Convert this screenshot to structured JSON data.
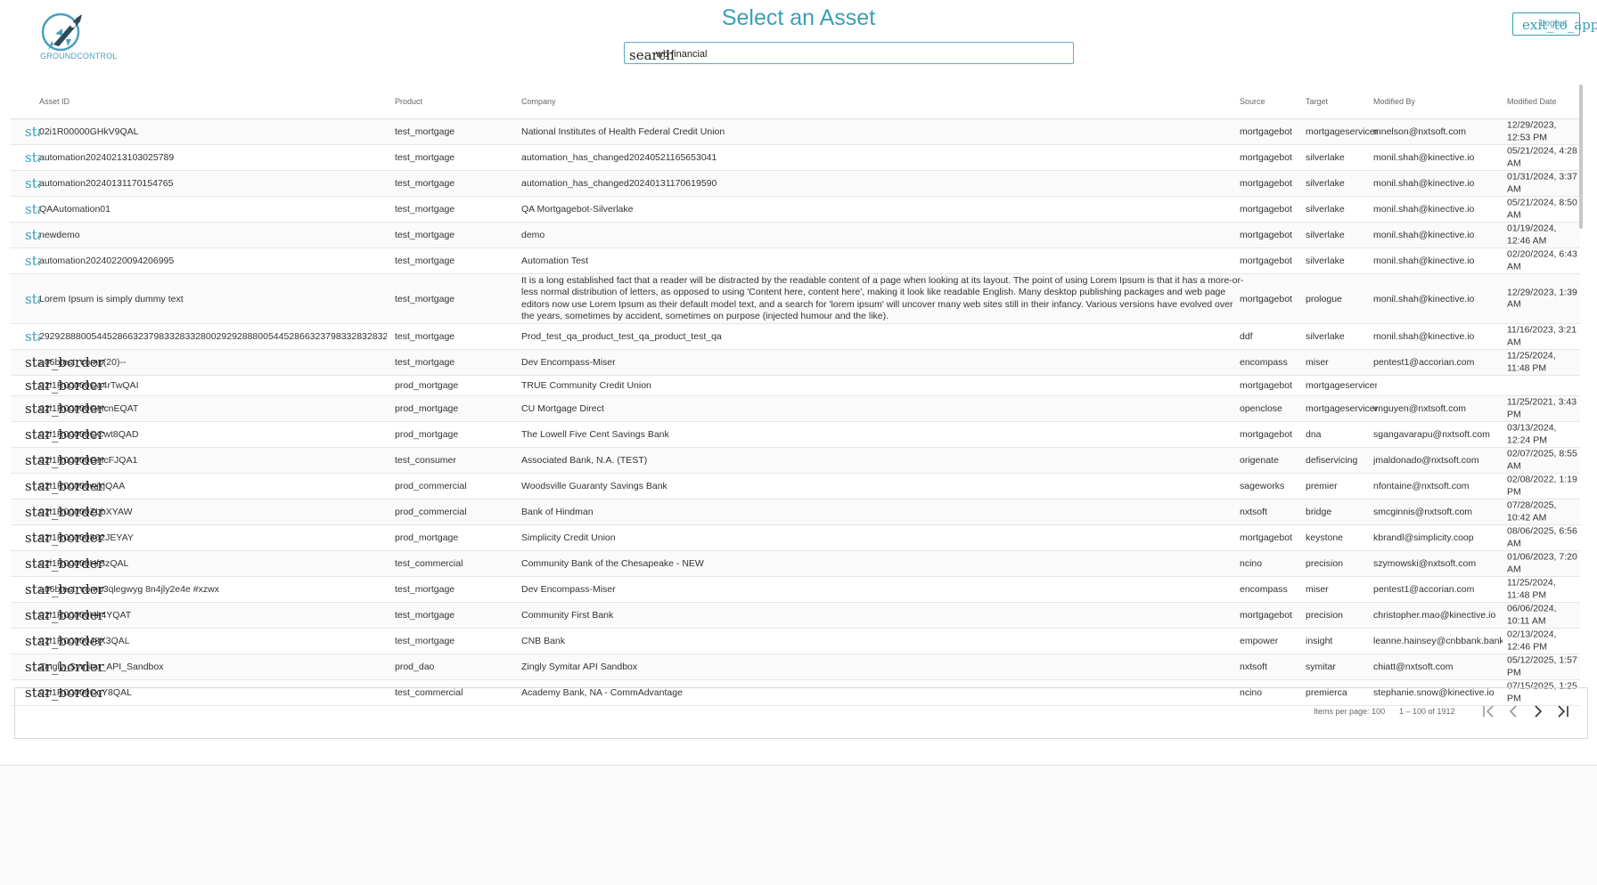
{
  "app": {
    "logo_text": "GROUNDCONTROL",
    "title": "Select an Asset",
    "search": {
      "icon_text": "search",
      "value": "wb financial"
    },
    "exit_button": {
      "label1": "exit_to_app",
      "label2": "Logout"
    },
    "colors": {
      "accent": "#3a9fb5"
    }
  },
  "table": {
    "headers": {
      "asset_id": "Asset ID",
      "product": "Product",
      "company": "Company",
      "source": "Source",
      "target": "Target",
      "modified_by": "Modified By",
      "modified_date": "Modified Date"
    },
    "rows": [
      {
        "star": "star",
        "starred": true,
        "id": "02i1R00000GHkV9QAL",
        "product": "test_mortgage",
        "company": "National Institutes of Health Federal Credit Union",
        "source": "mortgagebot",
        "target": "mortgageservicer",
        "modified_by": "mnelson@nxtsoft.com",
        "date": "12/29/2023, 12:53 PM"
      },
      {
        "star": "star",
        "starred": true,
        "id": "automation20240213103025789",
        "product": "test_mortgage",
        "company": "automation_has_changed20240521165653041",
        "source": "mortgagebot",
        "target": "silverlake",
        "modified_by": "monil.shah@kinective.io",
        "date": "05/21/2024, 4:28 AM"
      },
      {
        "star": "star",
        "starred": true,
        "id": "automation20240131170154765",
        "product": "test_mortgage",
        "company": "automation_has_changed20240131170619590",
        "source": "mortgagebot",
        "target": "silverlake",
        "modified_by": "monil.shah@kinective.io",
        "date": "01/31/2024, 3:37 AM"
      },
      {
        "star": "star",
        "starred": true,
        "id": "QAAutomation01",
        "product": "test_mortgage",
        "company": "QA Mortgagebot-Silverlake",
        "source": "mortgagebot",
        "target": "silverlake",
        "modified_by": "monil.shah@kinective.io",
        "date": "05/21/2024, 8:50 AM"
      },
      {
        "star": "star",
        "starred": true,
        "id": "newdemo",
        "product": "test_mortgage",
        "company": "demo",
        "source": "mortgagebot",
        "target": "silverlake",
        "modified_by": "monil.shah@kinective.io",
        "date": "01/19/2024, 12:46 AM"
      },
      {
        "star": "star",
        "starred": true,
        "id": "automation20240220094206995",
        "product": "test_mortgage",
        "company": "Automation Test",
        "source": "mortgagebot",
        "target": "silverlake",
        "modified_by": "monil.shah@kinective.io",
        "date": "02/20/2024, 6:43 AM"
      },
      {
        "star": "star",
        "starred": true,
        "id": "Lorem Ipsum is simply dummy text",
        "product": "test_mortgage",
        "company": "It is a long established fact that a reader will be distracted by the readable content of a page when looking at its layout. The point of using Lorem Ipsum is that it has a more-or-less normal distribution of letters, as opposed to using 'Content here, content here', making it look like readable English. Many desktop publishing packages and web page editors now use Lorem Ipsum as their default model text, and a search for 'lorem ipsum' will uncover many web sites still in their infancy. Various versions have evolved over the years, sometimes by accident, sometimes on purpose (injected humour and the like).",
        "source": "mortgagebot",
        "target": "prologue",
        "modified_by": "monil.shah@kinective.io",
        "date": "12/29/2023, 1:39 AM"
      },
      {
        "star": "star",
        "starred": true,
        "id": "2929288800544528663237983328332800292928880054452866323798332832832",
        "product": "test_mortgage",
        "company": "Prod_test_qa_product_test_qa_product_test_qa",
        "source": "ddf",
        "target": "silverlake",
        "modified_by": "monil.shah@kinective.io",
        "date": "11/16/2023, 3:21 AM"
      },
      {
        "star": "star_border",
        "starred": false,
        "id": "a06btest_comp(20)--",
        "product": "test_mortgage",
        "company": "Dev Encompass-Miser",
        "source": "encompass",
        "target": "miser",
        "modified_by": "pentest1@accorian.com",
        "date": "11/25/2024, 11:48 PM"
      },
      {
        "star": "star_border",
        "starred": false,
        "id": "02i1R00000Qa4rTwQAI",
        "product": "prod_mortgage",
        "company": "TRUE Community Credit Union",
        "source": "mortgagebot",
        "target": "mortgageservicer",
        "modified_by": "",
        "date": ""
      },
      {
        "star": "star_border",
        "starred": false,
        "id": "02i1R00000GHcnEQAT",
        "product": "prod_mortgage",
        "company": "CU Mortgage Direct",
        "source": "openclose",
        "target": "mortgageservicer",
        "modified_by": "vnguyen@nxtsoft.com",
        "date": "11/25/2021, 3:43 PM"
      },
      {
        "star": "star_border",
        "starred": false,
        "id": "02i1R00000QCwt8QAD",
        "product": "prod_mortgage",
        "company": "The Lowell Five Cent Savings Bank",
        "source": "mortgagebot",
        "target": "dna",
        "modified_by": "sgangavarapu@nxtsoft.com",
        "date": "03/13/2024, 12:24 PM"
      },
      {
        "star": "star_border",
        "starred": false,
        "id": "02i1R00000GHcFJQA1",
        "product": "test_consumer",
        "company": "Associated Bank, N.A. (TEST)",
        "source": "origenate",
        "target": "defiservicing",
        "modified_by": "jmaldonado@nxtsoft.com",
        "date": "02/07/2025, 8:55 AM"
      },
      {
        "star": "star_border",
        "starred": false,
        "id": "02i1R00000wjkjQAA",
        "product": "prod_commercial",
        "company": "Woodsville Guaranty Savings Bank",
        "source": "sageworks",
        "target": "premier",
        "modified_by": "nfontaine@nxtsoft.com",
        "date": "02/08/2022, 1:19 PM"
      },
      {
        "star": "star_border",
        "starred": false,
        "id": "02i1R00000ZLbXYAW",
        "product": "prod_commercial",
        "company": "Bank of Hindman",
        "source": "nxtsoft",
        "target": "bridge",
        "modified_by": "smcginnis@nxtsoft.com",
        "date": "07/28/2025, 10:42 AM"
      },
      {
        "star": "star_border",
        "starred": false,
        "id": "02i1R00000862JEYAY",
        "product": "prod_mortgage",
        "company": "Simplicity Credit Union",
        "source": "mortgagebot",
        "target": "keystone",
        "modified_by": "kbrandl@simplicity.coop",
        "date": "08/06/2025, 6:56 AM"
      },
      {
        "star": "star_border",
        "starred": false,
        "id": "02i1R00000HfSzQAL",
        "product": "test_commercial",
        "company": "Community Bank of the Chesapeake - NEW",
        "source": "ncino",
        "target": "precision",
        "modified_by": "szymowski@nxtsoft.com",
        "date": "01/06/2023, 7:20 AM"
      },
      {
        "star": "star_border",
        "starred": false,
        "id": "a06btest_comp3qlegwyg 8n4jly2e4e #xzwx",
        "product": "test_mortgage",
        "company": "Dev Encompass-Miser",
        "source": "encompass",
        "target": "miser",
        "modified_by": "pentest1@accorian.com",
        "date": "11/25/2024, 11:48 PM"
      },
      {
        "star": "star_border",
        "starred": false,
        "id": "02i1R00000Hk4YQAT",
        "product": "test_mortgage",
        "company": "Community First Bank",
        "source": "mortgagebot",
        "target": "precision",
        "modified_by": "christopher.mao@kinective.io",
        "date": "06/06/2024, 10:11 AM"
      },
      {
        "star": "star_border",
        "starred": false,
        "id": "02i1R00000J8X3QAL",
        "product": "test_mortgage",
        "company": "CNB Bank",
        "source": "empower",
        "target": "insight",
        "modified_by": "leanne.hainsey@cnbbank.bank",
        "date": "02/13/2024, 12:46 PM"
      },
      {
        "star": "star_border",
        "starred": false,
        "id": "Zingly_Symitar_API_Sandbox",
        "product": "prod_dao",
        "company": "Zingly Symitar API Sandbox",
        "source": "nxtsoft",
        "target": "symitar",
        "modified_by": "chiatt@nxtsoft.com",
        "date": "05/12/2025, 1:57 PM"
      },
      {
        "star": "star_border",
        "starred": false,
        "id": "02i1R00000CqY8QAL",
        "product": "test_commercial",
        "company": "Academy Bank, NA - CommAdvantage",
        "source": "ncino",
        "target": "premierca",
        "modified_by": "stephanie.snow@kinective.io",
        "date": "07/15/2025, 1:25 PM"
      }
    ]
  },
  "paginator": {
    "items_per_page_label": "Items per page:",
    "items_per_page": "100",
    "range": "1 – 100 of 1912",
    "first_icon": "first-page-icon",
    "prev_icon": "chevron-left-icon",
    "next_icon": "chevron-right-icon",
    "last_icon": "last-page-icon"
  }
}
